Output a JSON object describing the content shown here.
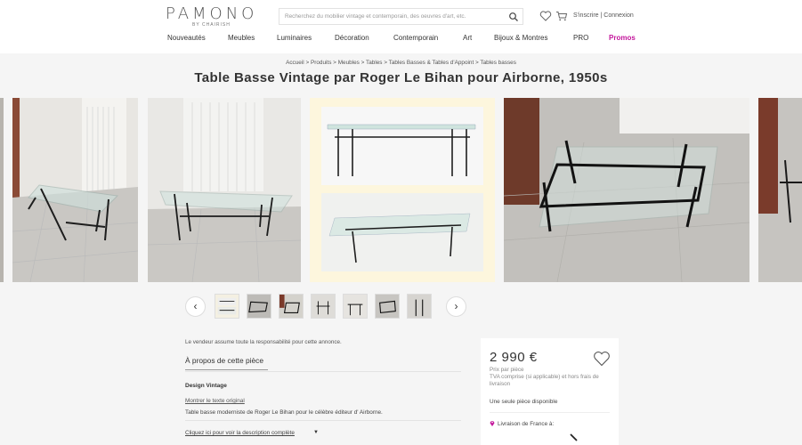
{
  "header": {
    "logo": "PAMONO",
    "logo_sub": "BY CHAIRISH",
    "search_placeholder": "Recherchez du mobilier vintage et contemporain, des oeuvres d'art, etc.",
    "auth_text": "S'inscrire | Connexion",
    "nav": [
      "Nouveautés",
      "Meubles",
      "Luminaires",
      "Décoration",
      "Contemporain",
      "Art",
      "Bijoux & Montres",
      "PRO",
      "Promos"
    ]
  },
  "breadcrumb": "Accueil > Produits > Meubles > Tables > Tables Basses & Tables d'Appoint > Tables basses",
  "title": "Table Basse Vintage par Roger Le Bihan pour Airborne, 1950s",
  "details": {
    "disclaimer": "Le vendeur assume toute la responsabilité pour cette annonce.",
    "about_tab": "À propos de cette pièce",
    "design_label": "Design Vintage",
    "original_link": "Montrer le texte original",
    "description": "Table basse moderniste de Roger Le Bihan pour le célèbre éditeur d' Airborne.",
    "more_link": "Cliquez ici pour voir la description complète"
  },
  "purchase": {
    "price": "2 990 €",
    "price_per": "Prix par pièce",
    "vat_note": "TVA comprise (si applicable) et hors frais de livraison",
    "stock": "Une seule pièce disponible",
    "shipping": "Livraison de France à:"
  },
  "colors": {
    "promo": "#c3169b",
    "background": "#f5f5f5"
  },
  "icons": [
    "search-icon",
    "heart-icon",
    "cart-icon",
    "chevron-left-icon",
    "chevron-right-icon",
    "location-pin-icon"
  ]
}
